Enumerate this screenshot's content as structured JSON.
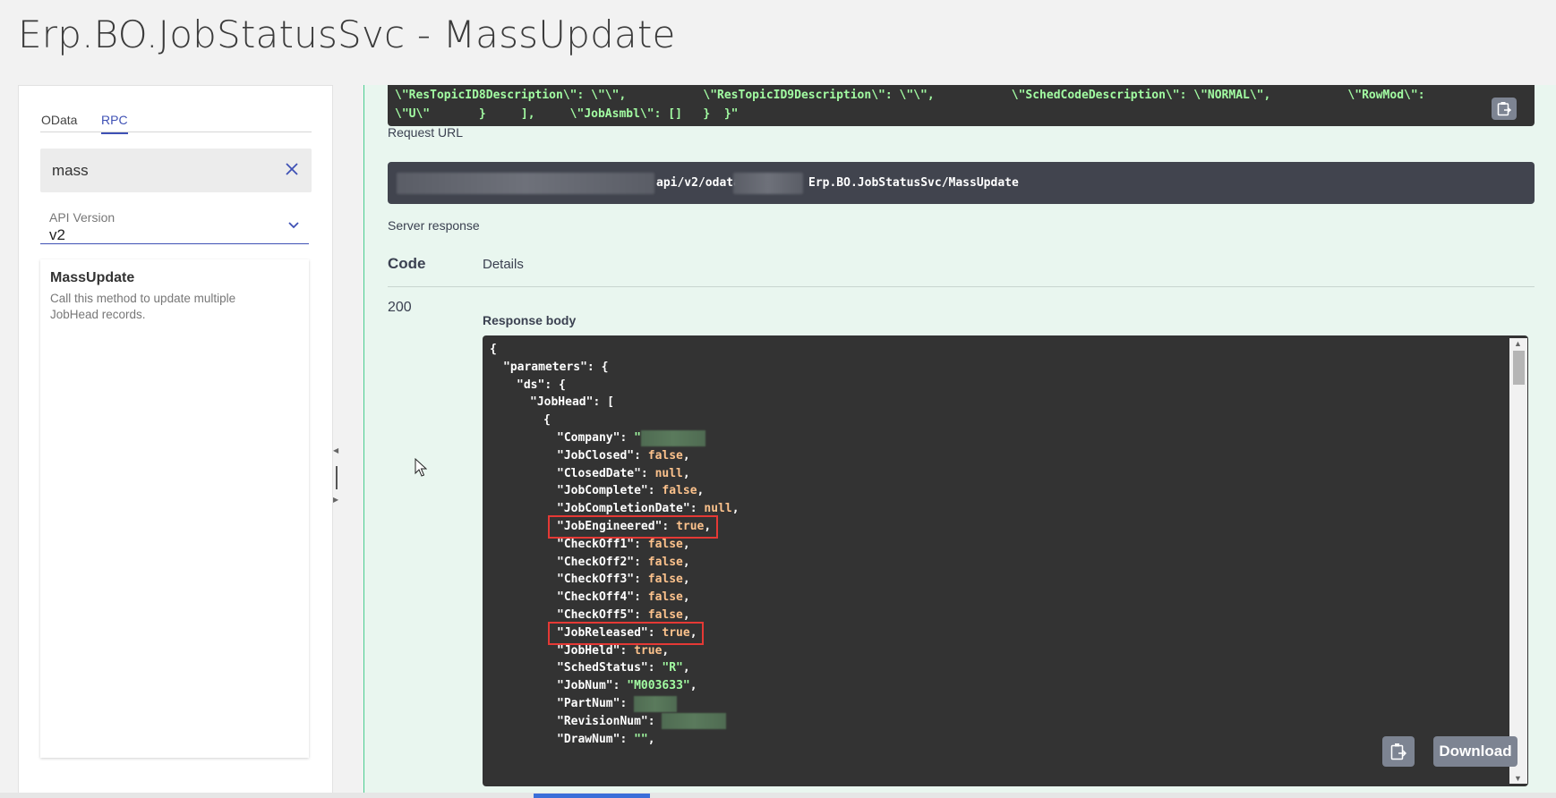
{
  "page": {
    "title": "Erp.BO.JobStatusSvc - MassUpdate"
  },
  "sidebar": {
    "tabs": [
      {
        "label": "OData"
      },
      {
        "label": "RPC"
      }
    ],
    "search": {
      "value": "mass"
    },
    "api_version": {
      "label": "API Version",
      "value": "v2"
    },
    "method": {
      "name": "MassUpdate",
      "description": "Call this method to update multiple JobHead records."
    }
  },
  "main": {
    "curl_lines": [
      "\\\"ResTopicID8Description\\\": \\\"\\\",           \\\"ResTopicID9Description\\\": \\\"\\\",           \\\"SchedCodeDescription\\\": \\\"NORMAL\\\",           \\\"RowMod\\\":",
      "\\\"U\\\"       }     ],     \\\"JobAsmbl\\\": []   }  }\""
    ],
    "request_url_label": "Request URL",
    "request_url_part1": "api/v2/odata",
    "request_url_part2": "Erp.BO.JobStatusSvc/MassUpdate",
    "server_response_label": "Server response",
    "code_header": "Code",
    "details_header": "Details",
    "status_code": "200",
    "response_body_label": "Response body",
    "download_label": "Download",
    "response_lines": [
      {
        "indent": 0,
        "text": "{"
      },
      {
        "indent": 1,
        "key": "\"parameters\"",
        "rest": ": {"
      },
      {
        "indent": 2,
        "key": "\"ds\"",
        "rest": ": {"
      },
      {
        "indent": 3,
        "key": "\"JobHead\"",
        "rest": ": ["
      },
      {
        "indent": 4,
        "text": "{"
      },
      {
        "indent": 5,
        "key": "\"Company\"",
        "rest": ": ",
        "val": "\"",
        "vtype": "s",
        "blur": true
      },
      {
        "indent": 5,
        "key": "\"JobClosed\"",
        "rest": ": ",
        "val": "false",
        "vtype": "b",
        "tail": ","
      },
      {
        "indent": 5,
        "key": "\"ClosedDate\"",
        "rest": ": ",
        "val": "null",
        "vtype": "b",
        "tail": ","
      },
      {
        "indent": 5,
        "key": "\"JobComplete\"",
        "rest": ": ",
        "val": "false",
        "vtype": "b",
        "tail": ","
      },
      {
        "indent": 5,
        "key": "\"JobCompletionDate\"",
        "rest": ": ",
        "val": "null",
        "vtype": "b",
        "tail": ","
      },
      {
        "indent": 5,
        "key": "\"JobEngineered\"",
        "rest": ": ",
        "val": "true",
        "vtype": "b",
        "tail": ",",
        "highlight": true
      },
      {
        "indent": 5,
        "key": "\"CheckOff1\"",
        "rest": ": ",
        "val": "false",
        "vtype": "b",
        "tail": ","
      },
      {
        "indent": 5,
        "key": "\"CheckOff2\"",
        "rest": ": ",
        "val": "false",
        "vtype": "b",
        "tail": ","
      },
      {
        "indent": 5,
        "key": "\"CheckOff3\"",
        "rest": ": ",
        "val": "false",
        "vtype": "b",
        "tail": ","
      },
      {
        "indent": 5,
        "key": "\"CheckOff4\"",
        "rest": ": ",
        "val": "false",
        "vtype": "b",
        "tail": ","
      },
      {
        "indent": 5,
        "key": "\"CheckOff5\"",
        "rest": ": ",
        "val": "false",
        "vtype": "b",
        "tail": ","
      },
      {
        "indent": 5,
        "key": "\"JobReleased\"",
        "rest": ": ",
        "val": "true",
        "vtype": "b",
        "tail": ",",
        "highlight": true
      },
      {
        "indent": 5,
        "key": "\"JobHeld\"",
        "rest": ": ",
        "val": "true",
        "vtype": "b",
        "tail": ","
      },
      {
        "indent": 5,
        "key": "\"SchedStatus\"",
        "rest": ": ",
        "val": "\"R\"",
        "vtype": "s",
        "tail": ","
      },
      {
        "indent": 5,
        "key": "\"JobNum\"",
        "rest": ": ",
        "val": "\"M003633\"",
        "vtype": "s",
        "tail": ","
      },
      {
        "indent": 5,
        "key": "\"PartNum\"",
        "rest": ": ",
        "blur": true
      },
      {
        "indent": 5,
        "key": "\"RevisionNum\"",
        "rest": ": ",
        "blur": true
      },
      {
        "indent": 5,
        "key": "\"DrawNum\"",
        "rest": ": ",
        "val": "\"\"",
        "vtype": "s",
        "tail": ","
      }
    ]
  }
}
